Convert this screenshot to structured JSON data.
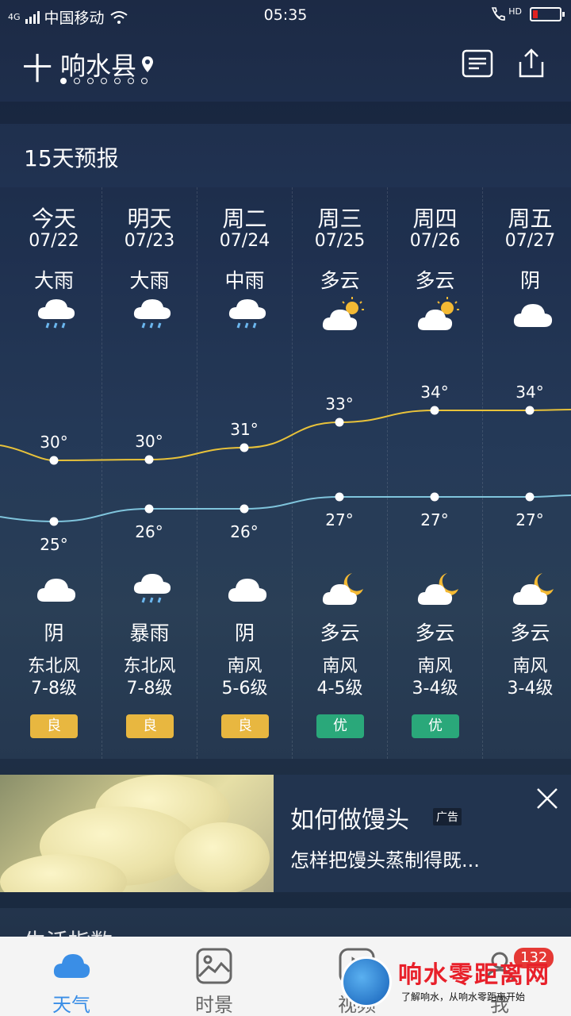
{
  "status_bar": {
    "network": "4G",
    "carrier": "中国移动",
    "time": "05:35",
    "hd": "HD",
    "battery_level": "low"
  },
  "header": {
    "add_label": "十",
    "city": "响水县",
    "pages_total": 7,
    "page_active": 1
  },
  "section_title": "15天预报",
  "forecast": [
    {
      "day": "今天",
      "date": "07/22",
      "day_cond": "大雨",
      "day_icon": "rain-cloud-icon",
      "high": "30°",
      "low": "25°",
      "night_icon": "cloud-icon",
      "night_cond": "阴",
      "wind_dir": "东北风",
      "wind_lvl": "7-8级",
      "aqi": "良",
      "aqi_level": "good"
    },
    {
      "day": "明天",
      "date": "07/23",
      "day_cond": "大雨",
      "day_icon": "rain-cloud-icon",
      "high": "30°",
      "low": "26°",
      "night_icon": "rain-cloud-icon",
      "night_cond": "暴雨",
      "wind_dir": "东北风",
      "wind_lvl": "7-8级",
      "aqi": "良",
      "aqi_level": "good"
    },
    {
      "day": "周二",
      "date": "07/24",
      "day_cond": "中雨",
      "day_icon": "rain-cloud-icon",
      "high": "31°",
      "low": "26°",
      "night_icon": "cloud-icon",
      "night_cond": "阴",
      "wind_dir": "南风",
      "wind_lvl": "5-6级",
      "aqi": "良",
      "aqi_level": "good"
    },
    {
      "day": "周三",
      "date": "07/25",
      "day_cond": "多云",
      "day_icon": "sun-cloud-icon",
      "high": "33°",
      "low": "27°",
      "night_icon": "moon-cloud-icon",
      "night_cond": "多云",
      "wind_dir": "南风",
      "wind_lvl": "4-5级",
      "aqi": "优",
      "aqi_level": "excellent"
    },
    {
      "day": "周四",
      "date": "07/26",
      "day_cond": "多云",
      "day_icon": "sun-cloud-icon",
      "high": "34°",
      "low": "27°",
      "night_icon": "moon-cloud-icon",
      "night_cond": "多云",
      "wind_dir": "南风",
      "wind_lvl": "3-4级",
      "aqi": "优",
      "aqi_level": "excellent"
    },
    {
      "day": "周五",
      "date": "07/27",
      "day_cond": "阴",
      "day_icon": "cloud-icon",
      "high": "34°",
      "low": "27°",
      "night_icon": "moon-cloud-icon",
      "night_cond": "多云",
      "wind_dir": "南风",
      "wind_lvl": "3-4级",
      "aqi": "",
      "aqi_level": ""
    }
  ],
  "colors": {
    "high_line": "#e8c23a",
    "low_line": "#7fc4dc",
    "aqi_good": "#e8b740",
    "aqi_excellent": "#2aa87a",
    "nav_active": "#3a8ee6"
  },
  "ad": {
    "title": "如何做馒头",
    "badge": "广告",
    "desc": "怎样把馒头蒸制得既..."
  },
  "life_index_title": "生活指数",
  "bottom_nav": [
    {
      "label": "天气",
      "icon": "cloud-icon",
      "active": true
    },
    {
      "label": "时景",
      "icon": "picture-icon",
      "active": false
    },
    {
      "label": "视频",
      "icon": "play-icon",
      "active": false
    },
    {
      "label": "我",
      "icon": "person-icon",
      "active": false,
      "badge": "132"
    }
  ],
  "watermark": {
    "title": "响水零距离网",
    "subtitle": "了解响水，从响水零距离开始"
  }
}
